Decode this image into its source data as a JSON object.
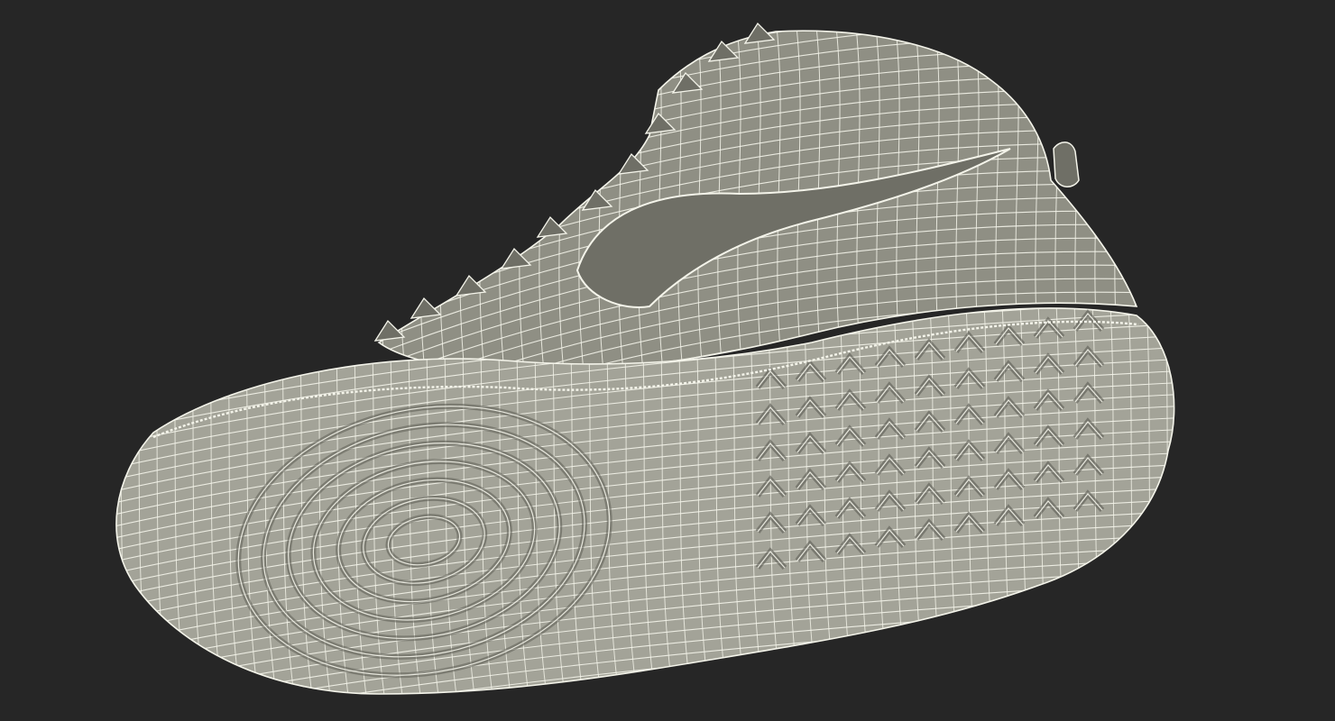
{
  "scene": {
    "subject": "sneaker-wireframe-render",
    "background_color": "#262626",
    "surface_color": "#8f8f84",
    "surface_shadow_color": "#6f6f66",
    "surface_highlight_color": "#a3a398",
    "wire_color": "#f4f4ea",
    "seam_color": "#5c5c54"
  }
}
